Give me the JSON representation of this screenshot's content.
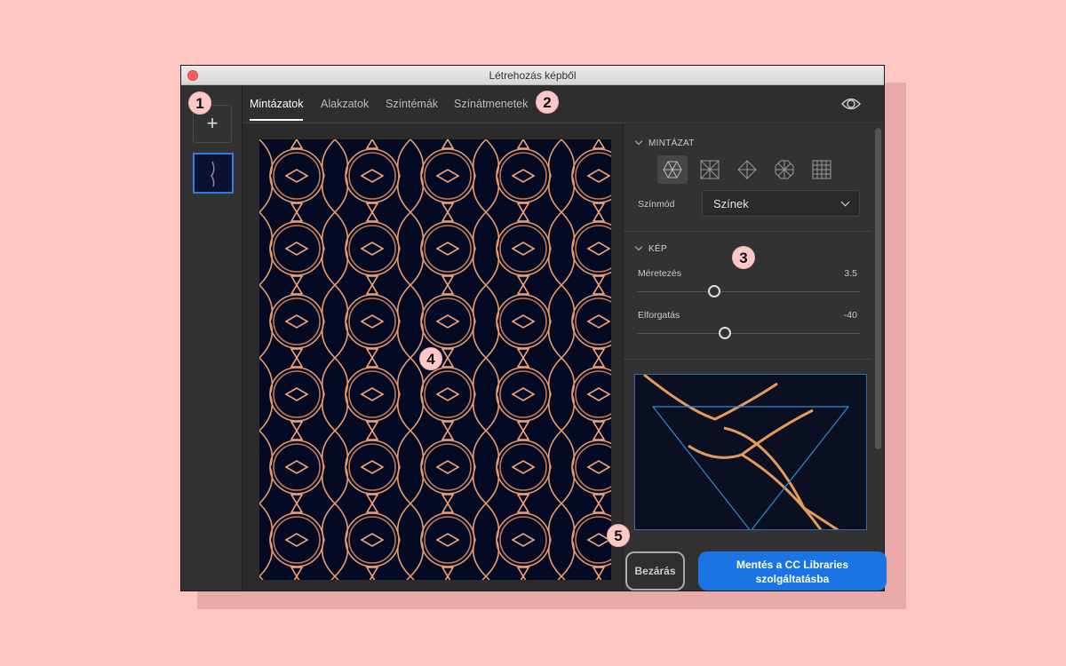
{
  "window": {
    "title": "Létrehozás képből"
  },
  "sidebar": {
    "add_label": "+"
  },
  "tabs": [
    {
      "label": "Mintázatok"
    },
    {
      "label": "Alakzatok"
    },
    {
      "label": "Színtémák"
    },
    {
      "label": "Színátmenetek"
    }
  ],
  "panel": {
    "pattern_section": {
      "title": "MINTÁZAT",
      "color_mode_label": "Színmód",
      "color_mode_value": "Színek"
    },
    "image_section": {
      "title": "KÉP",
      "scale_label": "Méretezés",
      "scale_value": "3.5",
      "rotation_label": "Elforgatás",
      "rotation_value": "-40"
    }
  },
  "buttons": {
    "close": "Bezárás",
    "save_line1": "Mentés a CC Libraries",
    "save_line2": "szolgáltatásba"
  },
  "callouts": [
    "1",
    "2",
    "3",
    "4",
    "5"
  ],
  "colors": {
    "accent": "#1b74e4",
    "pattern_bg": "#050a24",
    "pattern_line": "#e89a6a"
  }
}
